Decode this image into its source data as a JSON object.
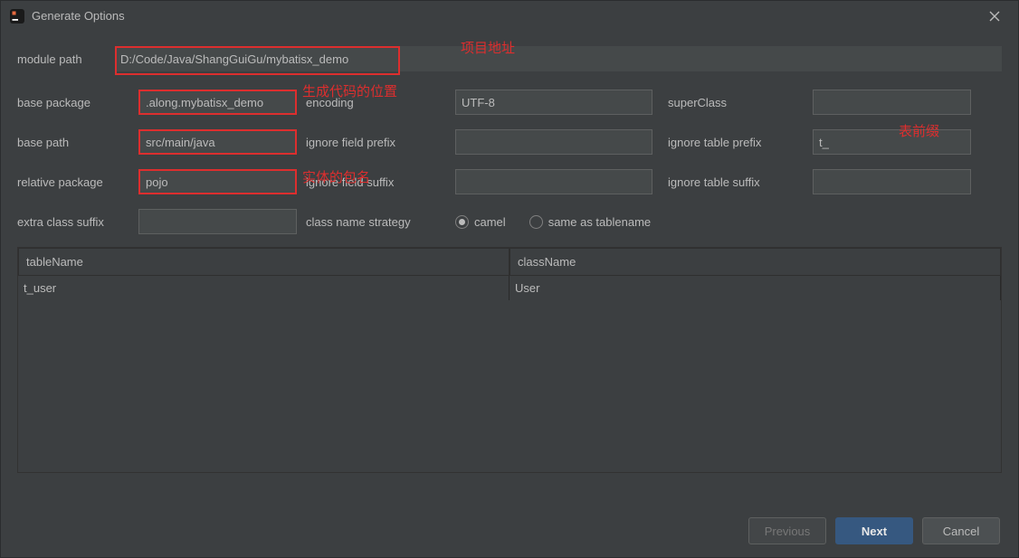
{
  "window": {
    "title": "Generate Options"
  },
  "fields": {
    "module_path": {
      "label": "module path",
      "value": "D:/Code/Java/ShangGuiGu/mybatisx_demo"
    },
    "base_package": {
      "label": "base package",
      "value": ".along.mybatisx_demo"
    },
    "encoding": {
      "label": "encoding",
      "value": "UTF-8"
    },
    "super_class": {
      "label": "superClass",
      "value": ""
    },
    "base_path": {
      "label": "base path",
      "value": "src/main/java"
    },
    "ignore_field_prefix": {
      "label": "ignore field prefix",
      "value": ""
    },
    "ignore_table_prefix": {
      "label": "ignore table prefix",
      "value": "t_"
    },
    "relative_package": {
      "label": "relative package",
      "value": "pojo"
    },
    "ignore_field_suffix": {
      "label": "ignore field suffix",
      "value": ""
    },
    "ignore_table_suffix": {
      "label": "ignore table suffix",
      "value": ""
    },
    "extra_class_suffix": {
      "label": "extra class suffix",
      "value": ""
    },
    "class_name_strategy": {
      "label": "class name strategy",
      "options": {
        "camel": "camel",
        "same": "same as tablename"
      },
      "selected": "camel"
    }
  },
  "table": {
    "headers": {
      "tableName": "tableName",
      "className": "className"
    },
    "rows": [
      {
        "tableName": "t_user",
        "className": "User"
      }
    ]
  },
  "buttons": {
    "previous": "Previous",
    "next": "Next",
    "cancel": "Cancel"
  },
  "annotations": {
    "module_path": "项目地址",
    "base_package": "生成代码的位置",
    "ignore_table_prefix": "表前缀",
    "relative_package": "实体的包名"
  }
}
